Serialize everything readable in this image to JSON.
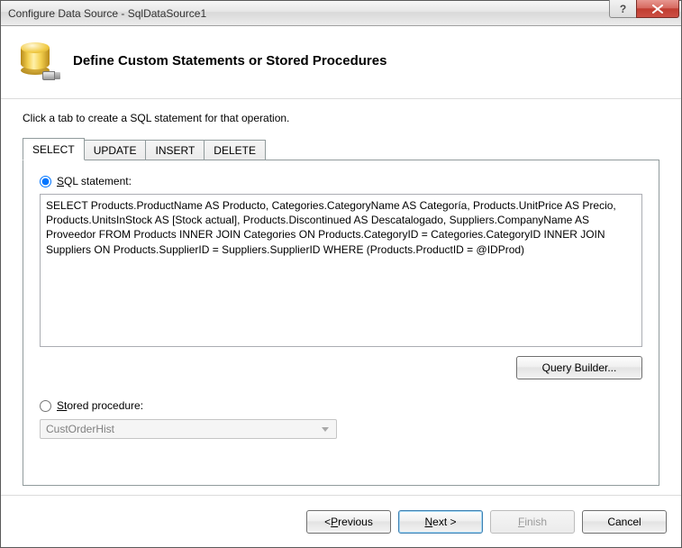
{
  "window": {
    "title": "Configure Data Source - SqlDataSource1"
  },
  "header": {
    "title": "Define Custom Statements or Stored Procedures"
  },
  "instruction": "Click a tab to create a SQL statement for that operation.",
  "tabs": {
    "select": "SELECT",
    "update": "UPDATE",
    "insert": "INSERT",
    "delete": "DELETE"
  },
  "options": {
    "sql_label_prefix": "S",
    "sql_label_rest": "QL statement:",
    "sp_label_prefix": "St",
    "sp_label_rest": "ored procedure:"
  },
  "sql_text": "SELECT Products.ProductName AS Producto, Categories.CategoryName AS Categoría, Products.UnitPrice AS Precio, Products.UnitsInStock AS [Stock actual], Products.Discontinued AS Descatalogado, Suppliers.CompanyName AS Proveedor FROM Products INNER JOIN Categories ON Products.CategoryID = Categories.CategoryID INNER JOIN Suppliers ON Products.SupplierID = Suppliers.SupplierID WHERE (Products.ProductID = @IDProd)",
  "stored_procedure_value": "CustOrderHist",
  "buttons": {
    "query_builder": "Query Builder...",
    "previous_glyph": "< ",
    "previous_u": "P",
    "previous_rest": "revious",
    "next_u": "N",
    "next_rest": "ext >",
    "finish_pre": "",
    "finish_u": "F",
    "finish_rest": "inish",
    "cancel": "Cancel"
  }
}
